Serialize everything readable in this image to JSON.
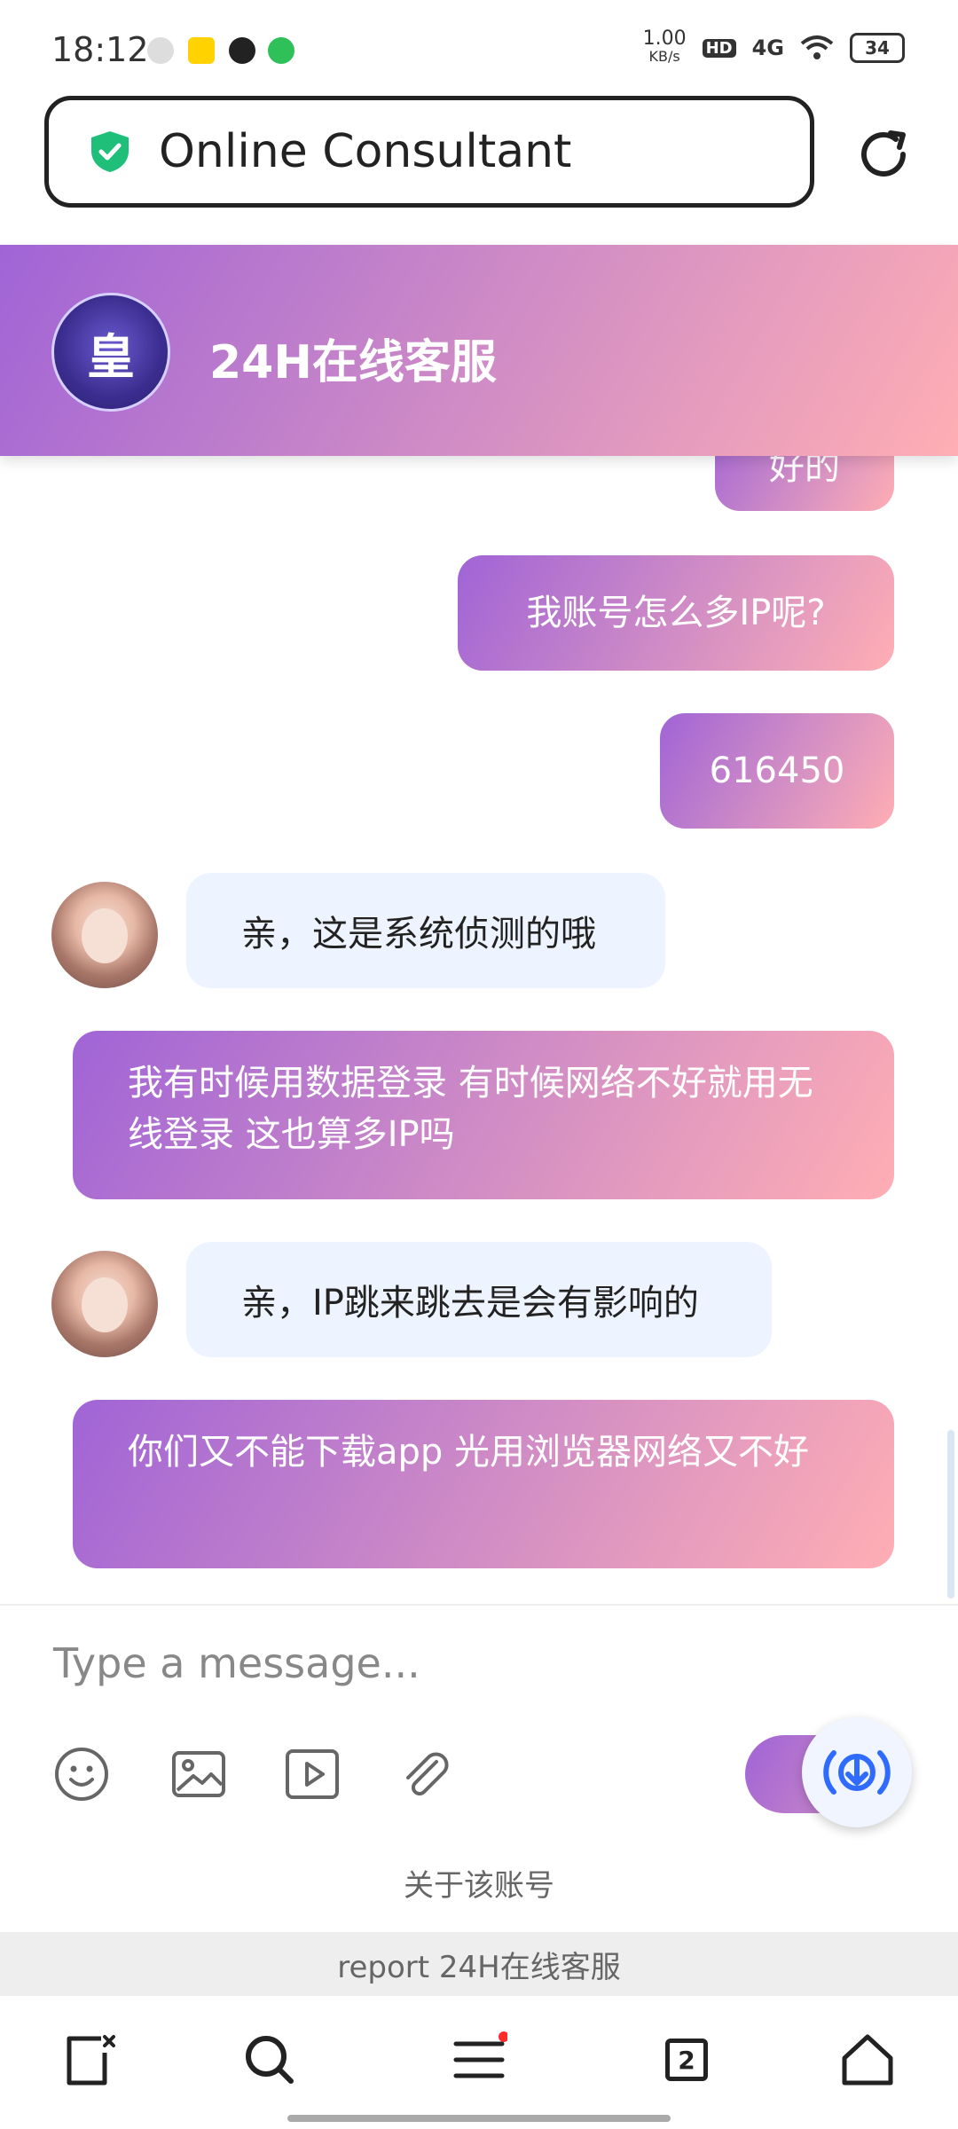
{
  "status_bar": {
    "time": "18:12",
    "net_speed_value": "1.00",
    "net_speed_unit": "KB/s",
    "hd": "HD",
    "signal": "4G",
    "battery": "34"
  },
  "browser": {
    "url_title": "Online Consultant"
  },
  "chat_header": {
    "title": "24H在线客服",
    "logo_text": "皇"
  },
  "messages": [
    {
      "from": "user",
      "text": "好的"
    },
    {
      "from": "user",
      "text": "我账号怎么多IP呢?"
    },
    {
      "from": "user",
      "text": "616450"
    },
    {
      "from": "agent",
      "text": "亲，这是系统侦测的哦"
    },
    {
      "from": "user",
      "text": "我有时候用数据登录 有时候网络不好就用无线登录 这也算多IP吗"
    },
    {
      "from": "agent",
      "text": "亲，IP跳来跳去是会有影响的"
    },
    {
      "from": "user",
      "text": "你们又不能下载app  光用浏览器网络又不好"
    }
  ],
  "composer": {
    "placeholder": "Type a message...",
    "tools": [
      "emoji-icon",
      "image-icon",
      "video-icon",
      "attachment-icon"
    ]
  },
  "footer": {
    "about": "关于该账号",
    "report": "report 24H在线客服"
  },
  "nav": {
    "tabs_count": "2"
  },
  "colors": {
    "gradient_start": "#a064d6",
    "gradient_end": "#ffaeb4",
    "agent_bubble": "#eef4ff",
    "shield": "#1fbf7a"
  }
}
